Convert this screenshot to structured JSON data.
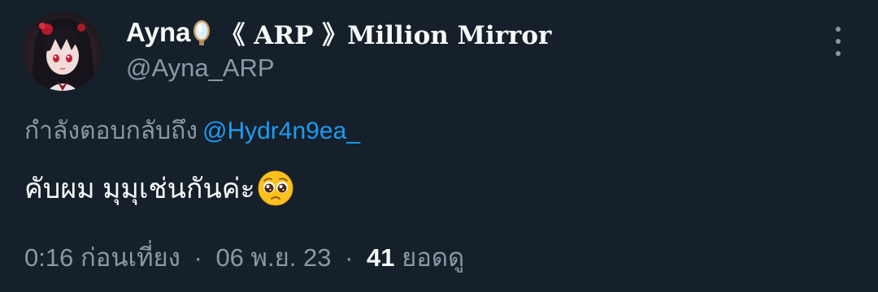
{
  "author": {
    "display_name": "Ayna",
    "name_rest": "《 ARP 》Million Mirror",
    "handle": "@Ayna_ARP",
    "name_emoji": "mirror-icon"
  },
  "reply": {
    "prefix": "กำลังตอบกลับถึง",
    "mention": "@Hydr4n9ea_"
  },
  "tweet": {
    "text": "คับผม มุมุเช่นกันค่ะ",
    "emoji": "pleading-face-icon"
  },
  "meta": {
    "time": "0:16 ก่อนเที่ยง",
    "separator": "·",
    "date": "06 พ.ย. 23",
    "views_count": "41",
    "views_label": "ยอดดู"
  },
  "colors": {
    "background": "#15202b",
    "primary_text": "#f7f9f9",
    "secondary_text": "#8b98a5",
    "link": "#1d9bf0"
  }
}
